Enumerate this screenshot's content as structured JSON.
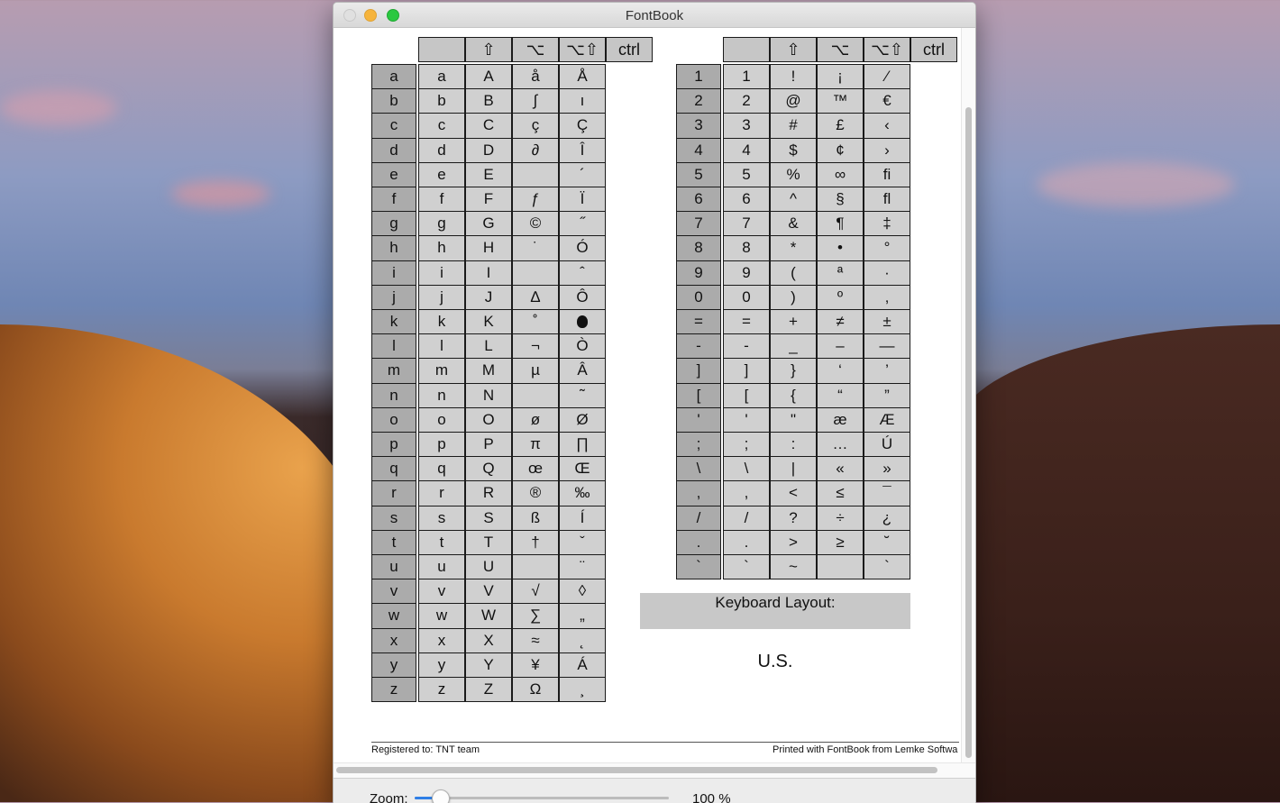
{
  "window": {
    "title": "FontBook"
  },
  "left_table": {
    "headers": [
      "",
      "⇧",
      "⌥",
      "⌥⇧",
      "ctrl"
    ],
    "rows": [
      [
        "a",
        "a",
        "A",
        "å",
        "Å"
      ],
      [
        "b",
        "b",
        "B",
        "∫",
        "ı"
      ],
      [
        "c",
        "c",
        "C",
        "ç",
        "Ç"
      ],
      [
        "d",
        "d",
        "D",
        "∂",
        "Î"
      ],
      [
        "e",
        "e",
        "E",
        "",
        "´"
      ],
      [
        "f",
        "f",
        "F",
        "ƒ",
        "Ï"
      ],
      [
        "g",
        "g",
        "G",
        "©",
        "˝"
      ],
      [
        "h",
        "h",
        "H",
        "˙",
        "Ó"
      ],
      [
        "i",
        "i",
        "I",
        "",
        "ˆ"
      ],
      [
        "j",
        "j",
        "J",
        "∆",
        "Ô"
      ],
      [
        "k",
        "k",
        "K",
        "˚",
        ""
      ],
      [
        "l",
        "l",
        "L",
        "¬",
        "Ò"
      ],
      [
        "m",
        "m",
        "M",
        "µ",
        "Â"
      ],
      [
        "n",
        "n",
        "N",
        "",
        "˜"
      ],
      [
        "o",
        "o",
        "O",
        "ø",
        "Ø"
      ],
      [
        "p",
        "p",
        "P",
        "π",
        "∏"
      ],
      [
        "q",
        "q",
        "Q",
        "œ",
        "Œ"
      ],
      [
        "r",
        "r",
        "R",
        "®",
        "‰"
      ],
      [
        "s",
        "s",
        "S",
        "ß",
        "Í"
      ],
      [
        "t",
        "t",
        "T",
        "†",
        "ˇ"
      ],
      [
        "u",
        "u",
        "U",
        "",
        "¨"
      ],
      [
        "v",
        "v",
        "V",
        "√",
        "◊"
      ],
      [
        "w",
        "w",
        "W",
        "∑",
        "„"
      ],
      [
        "x",
        "x",
        "X",
        "≈",
        "˛"
      ],
      [
        "y",
        "y",
        "Y",
        "¥",
        "Á"
      ],
      [
        "z",
        "z",
        "Z",
        "Ω",
        "¸"
      ]
    ]
  },
  "right_table": {
    "headers": [
      "",
      "⇧",
      "⌥",
      "⌥⇧",
      "ctrl"
    ],
    "rows": [
      [
        "1",
        "1",
        "!",
        "¡",
        "⁄"
      ],
      [
        "2",
        "2",
        "@",
        "™",
        "€"
      ],
      [
        "3",
        "3",
        "#",
        "£",
        "‹"
      ],
      [
        "4",
        "4",
        "$",
        "¢",
        "›"
      ],
      [
        "5",
        "5",
        "%",
        "∞",
        "ﬁ"
      ],
      [
        "6",
        "6",
        "^",
        "§",
        "ﬂ"
      ],
      [
        "7",
        "7",
        "&",
        "¶",
        "‡"
      ],
      [
        "8",
        "8",
        "*",
        "•",
        "°"
      ],
      [
        "9",
        "9",
        "(",
        "ª",
        "·"
      ],
      [
        "0",
        "0",
        ")",
        "º",
        "‚"
      ],
      [
        "=",
        "=",
        "+",
        "≠",
        "±"
      ],
      [
        "-",
        "-",
        "_",
        "–",
        "—"
      ],
      [
        "]",
        "]",
        "}",
        "‘",
        "’"
      ],
      [
        "[",
        "[",
        "{",
        "“",
        "”"
      ],
      [
        "'",
        "'",
        "\"",
        "æ",
        "Æ"
      ],
      [
        ";",
        ";",
        ":",
        "…",
        "Ú"
      ],
      [
        "\\",
        "\\",
        "|",
        "«",
        "»"
      ],
      [
        ",",
        ",",
        "<",
        "≤",
        "¯"
      ],
      [
        "/",
        "/",
        "?",
        "÷",
        "¿"
      ],
      [
        ".",
        ".",
        ">",
        "≥",
        "˘"
      ],
      [
        "`",
        "`",
        "~",
        "",
        "`"
      ]
    ]
  },
  "keyboard_layout": {
    "label": "Keyboard Layout:",
    "value": "U.S."
  },
  "footer": {
    "left": "Registered to: TNT team",
    "right": "Printed with FontBook from Lemke Softwa"
  },
  "statusbar": {
    "zoom_label": "Zoom:",
    "zoom_value": "100 %",
    "zoom_fraction": 0.1
  },
  "icons": {
    "apple_logo_cell": "apple-logo-icon"
  }
}
